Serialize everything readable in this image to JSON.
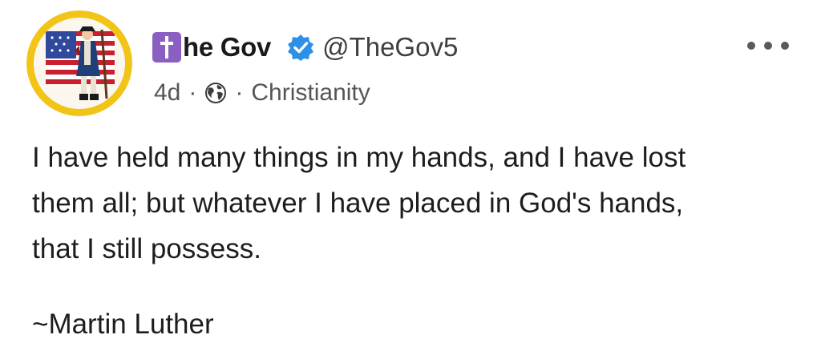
{
  "post": {
    "author": {
      "display_name": "he Gov",
      "badge_icon": "latin-cross-icon",
      "badge_color": "#8b5fc2",
      "verified_icon": "verified-check-icon",
      "verified_color": "#1d9bf0",
      "handle": "@TheGov5",
      "avatar_icon": "patriot-soldier-flag-avatar"
    },
    "meta": {
      "time": "4d",
      "separator": "·",
      "visibility_icon": "globe-icon",
      "community": "Christianity"
    },
    "more_icon": "more-options-icon",
    "body_lines": [
      "I have held many things in my hands, and I have lost",
      "them all; but whatever I have placed in God's hands,",
      "that I still possess."
    ],
    "signature": "~Martin Luther"
  }
}
